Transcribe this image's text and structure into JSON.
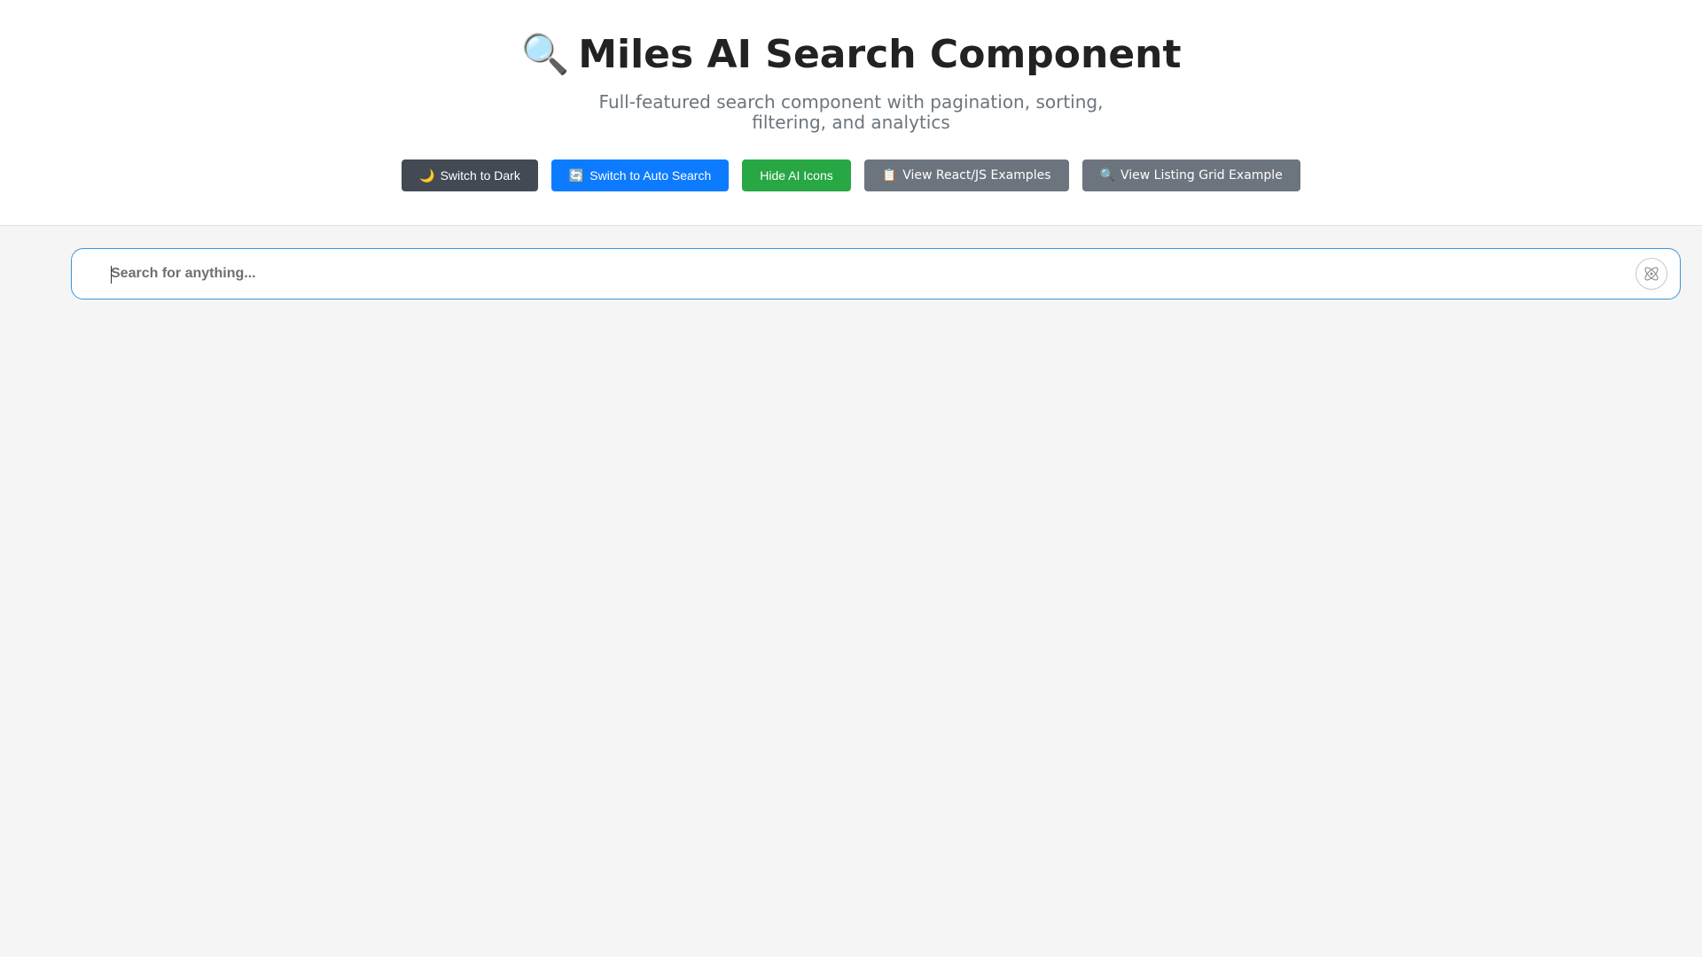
{
  "header": {
    "title_icon": "🔍",
    "title": "Miles AI Search Component",
    "subtitle": "Full-featured search component with pagination, sorting, filtering, and analytics"
  },
  "toolbar": {
    "buttons": [
      {
        "icon": "🌙",
        "icon_name": "moon-icon",
        "label": "Switch to Dark",
        "color": "#434a54"
      },
      {
        "icon": "🔄",
        "icon_name": "refresh-icon",
        "label": "Switch to Auto Search",
        "color": "#0d7bff"
      },
      {
        "icon": "",
        "icon_name": "",
        "label": "Hide AI Icons",
        "color": "#28a745"
      },
      {
        "icon": "📋",
        "icon_name": "clipboard-icon",
        "label": "View React/JS Examples",
        "color": "#6c757d"
      },
      {
        "icon": "🔍",
        "icon_name": "search-icon",
        "label": "View Listing Grid Example",
        "color": "#6c757d"
      }
    ]
  },
  "search": {
    "placeholder": "Search for anything...",
    "value": "",
    "ai_icon": "atom-icon",
    "border_color": "#3b95dc"
  }
}
